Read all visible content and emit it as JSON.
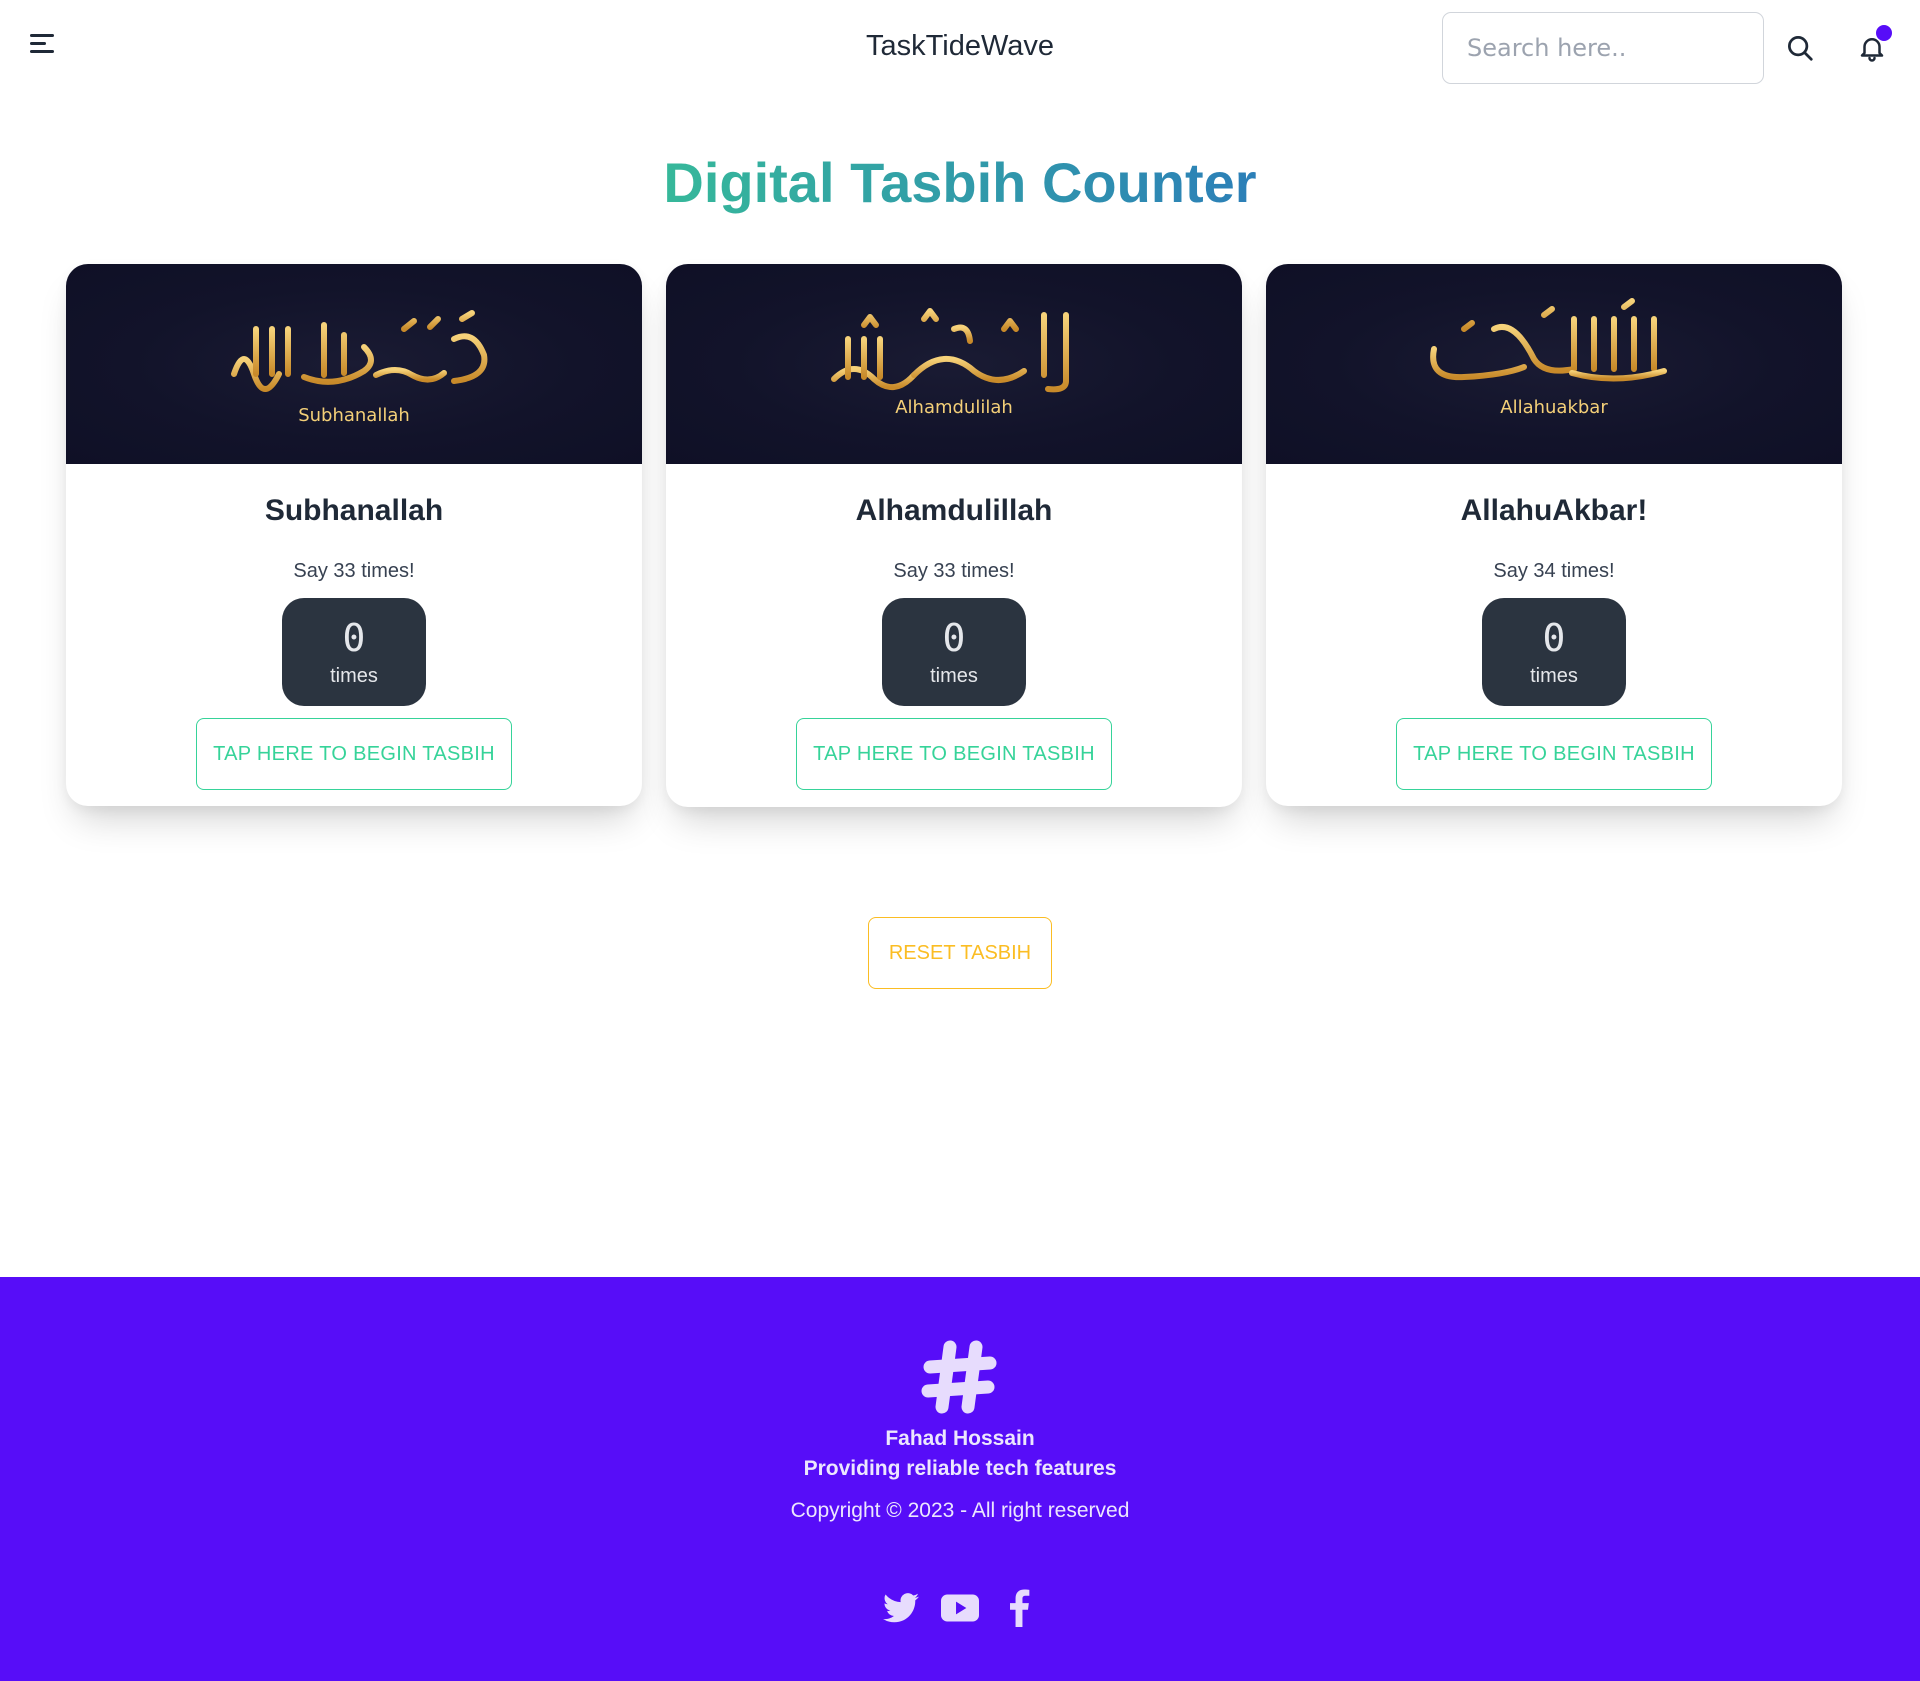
{
  "navbar": {
    "brand": "TaskTideWave",
    "search_placeholder": "Search here..",
    "menu_icon": "hamburger-menu-icon",
    "search_icon": "search-icon",
    "bell_icon": "bell-icon"
  },
  "page": {
    "title": "Digital Tasbih Counter"
  },
  "cards": [
    {
      "image_caption": "Subhanallah",
      "title": "Subhanallah",
      "instruction": "Say 33 times!",
      "count": "0",
      "count_label": "times",
      "button_label": "TAP HERE TO BEGIN TASBIH"
    },
    {
      "image_caption": "Alhamdulilah",
      "title": "Alhamdulillah",
      "instruction": "Say 33 times!",
      "count": "0",
      "count_label": "times",
      "button_label": "TAP HERE TO BEGIN TASBIH"
    },
    {
      "image_caption": "Allahuakbar",
      "title": "AllahuAkbar!",
      "instruction": "Say 34 times!",
      "count": "0",
      "count_label": "times",
      "button_label": "TAP HERE TO BEGIN TASBIH"
    }
  ],
  "reset_button": "RESET TASBIH",
  "footer": {
    "logo_icon": "slack-hash-logo-icon",
    "name": "Fahad Hossain",
    "tagline": "Providing reliable tech features",
    "copyright": "Copyright © 2023 - All right reserved",
    "socials": [
      "twitter-icon",
      "youtube-icon",
      "facebook-icon"
    ]
  },
  "colors": {
    "primary": "#570df8",
    "success": "#36d399",
    "warning": "#fbbd23",
    "counter_bg": "#2b3440",
    "card_banner_bg": "#12132a",
    "gold": "#e6b24a",
    "title_gradient_start": "#36b89a",
    "title_gradient_end": "#2c7fb8"
  }
}
